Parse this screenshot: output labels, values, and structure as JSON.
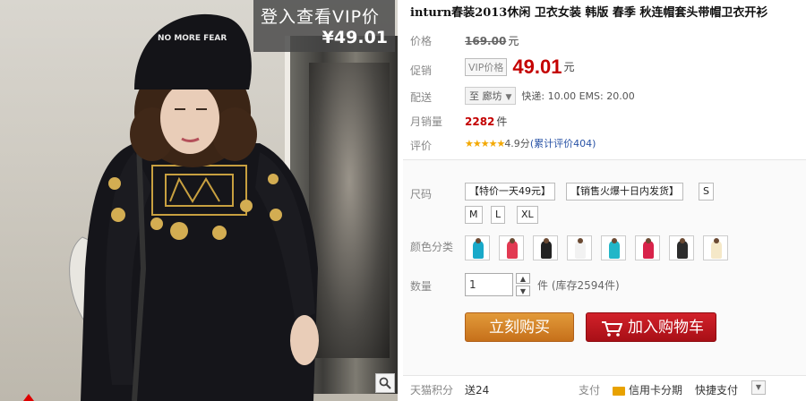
{
  "badge": {
    "line1": "登入查看VIP价",
    "line2": "¥49.01"
  },
  "photo": {
    "cap_text": "NO MORE FEAR"
  },
  "product": {
    "title": "inturn春装2013休闲 卫衣女装 韩版 春季 秋连帽套头带帽卫衣开衫"
  },
  "price": {
    "label": "价格",
    "original": "169.00",
    "unit": "元"
  },
  "promo": {
    "label": "促销",
    "tag": "VIP价格",
    "price": "49.01",
    "unit": "元"
  },
  "delivery": {
    "label": "配送",
    "destination": "至 廊坊",
    "shipping": "快递: 10.00 EMS: 20.00"
  },
  "sales": {
    "label": "月销量",
    "count": "2282",
    "unit": "件"
  },
  "rating": {
    "label": "评价",
    "stars": "★★★★★",
    "score": "4.9分",
    "reviews": "(累计评价404)"
  },
  "size": {
    "label": "尺码",
    "options": [
      "【特价一天49元】",
      "【销售火爆十日内发货】",
      "S",
      "M",
      "L",
      "XL"
    ]
  },
  "color": {
    "label": "颜色分类",
    "swatches": [
      "#19a9c9",
      "#e23a52",
      "#222222",
      "#f2f2f2",
      "#22b6c8",
      "#d8234a",
      "#2c2c2c",
      "#f5e8c8"
    ]
  },
  "quantity": {
    "label": "数量",
    "value": "1",
    "stock": "件 (库存2594件)"
  },
  "buttons": {
    "buy_now": "立刻购买",
    "add_cart": "加入购物车"
  },
  "footer": {
    "points_label": "天猫积分",
    "points_value": "送24",
    "payment_label": "支付",
    "credit": "信用卡分期",
    "fast_pay": "快捷支付"
  }
}
